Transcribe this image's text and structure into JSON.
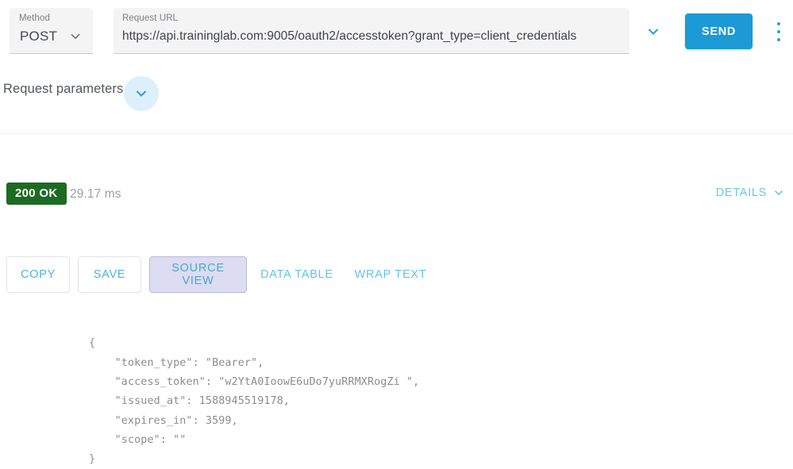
{
  "request": {
    "method_label": "Method",
    "method_value": "POST",
    "url_label": "Request URL",
    "url_value": "https://api.traininglab.com:9005/oauth2/accesstoken?grant_type=client_credentials",
    "send_label": "SEND",
    "expand_icon": "chevron-down-icon",
    "menu_icon": "kebab-menu-icon"
  },
  "parameters": {
    "label": "Request parameters",
    "toggle_icon": "chevron-down-icon"
  },
  "response": {
    "status_code": "200 OK",
    "status_color": "#1d6b22",
    "duration": "29.17 ms",
    "details_label": "DETAILS",
    "details_icon": "chevron-down-icon",
    "actions": [
      {
        "label": "COPY",
        "active": false,
        "style": "outline"
      },
      {
        "label": "SAVE",
        "active": false,
        "style": "outline"
      },
      {
        "label": "SOURCE VIEW",
        "active": true,
        "style": "outline"
      },
      {
        "label": "DATA TABLE",
        "active": false,
        "style": "text"
      },
      {
        "label": "WRAP TEXT",
        "active": false,
        "style": "text"
      }
    ],
    "body": "{\n    \"token_type\": \"Bearer\",\n    \"access_token\": \"w2YtA0IoowE6uDo7yuRRMXRogZi \",\n    \"issued_at\": 1588945519178,\n    \"expires_in\": 3599,\n    \"scope\": \"\"\n}",
    "body_fields": {
      "token_type": "Bearer",
      "access_token": "w2YtA0IoowE6uDo7yuRRMXRogZi ",
      "issued_at": 1588945519178,
      "expires_in": 3599,
      "scope": ""
    }
  },
  "colors": {
    "accent_blue": "#1c9ad6",
    "link_blue": "#66c2e6",
    "active_lavender": "#dcdcf2",
    "success_green": "#1d6b22"
  }
}
